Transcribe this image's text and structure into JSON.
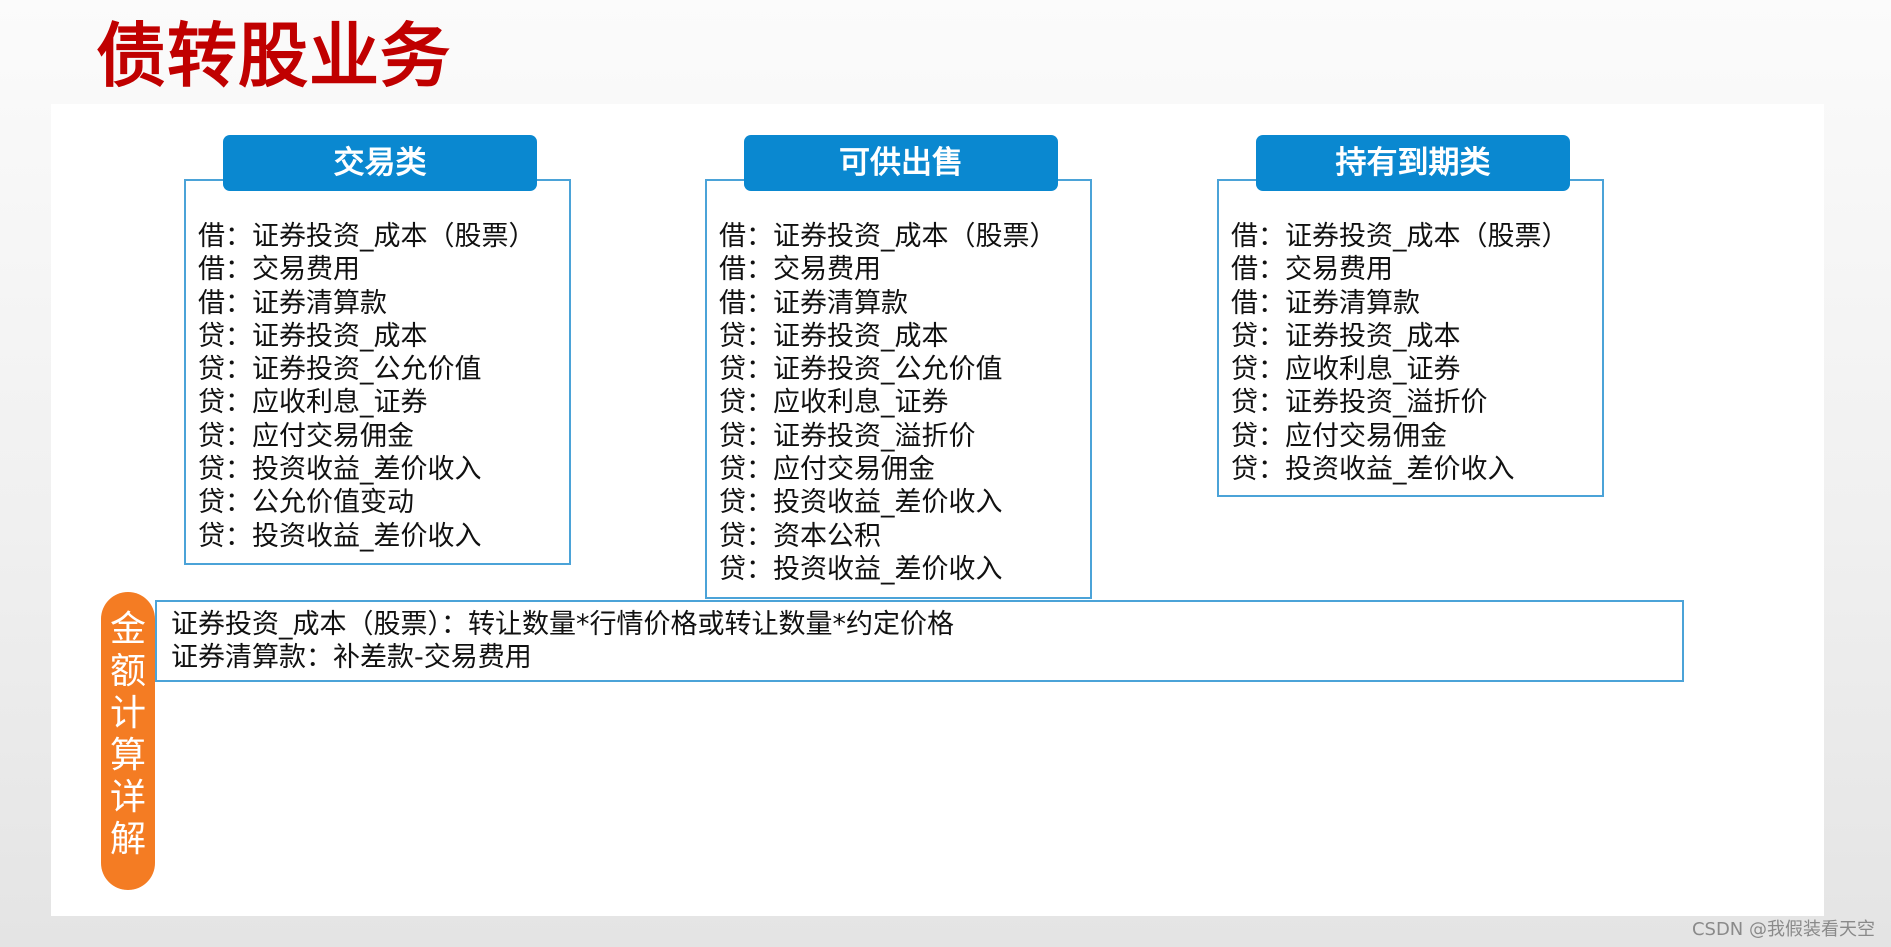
{
  "title": "债转股业务",
  "columns": [
    {
      "header": "交易类",
      "entries": [
        "借：证券投资_成本（股票）",
        "借：交易费用",
        "借：证券清算款",
        "贷：证券投资_成本",
        "贷：证券投资_公允价值",
        "贷：应收利息_证券",
        "贷：应付交易佣金",
        "贷：投资收益_差价收入",
        "贷：公允价值变动",
        "贷：投资收益_差价收入"
      ]
    },
    {
      "header": "可供出售",
      "entries": [
        "借：证券投资_成本（股票）",
        "借：交易费用",
        "借：证券清算款",
        "贷：证券投资_成本",
        "贷：证券投资_公允价值",
        "贷：应收利息_证券",
        "贷：证券投资_溢折价",
        "贷：应付交易佣金",
        "贷：投资收益_差价收入",
        "贷：资本公积",
        "贷：投资收益_差价收入"
      ]
    },
    {
      "header": "持有到期类",
      "entries": [
        "借：证券投资_成本（股票）",
        "借：交易费用",
        "借：证券清算款",
        "贷：证券投资_成本",
        "贷：应收利息_证券",
        "贷：证券投资_溢折价",
        "贷：应付交易佣金",
        "贷：投资收益_差价收入"
      ]
    }
  ],
  "calculation": {
    "label": [
      "金",
      "额",
      "计",
      "算",
      "详",
      "解"
    ],
    "lines": [
      "证券投资_成本（股票）：转让数量*行情价格或转让数量*约定价格",
      "证券清算款：补差款-交易费用"
    ]
  },
  "watermark": "CSDN @我假装看天空"
}
